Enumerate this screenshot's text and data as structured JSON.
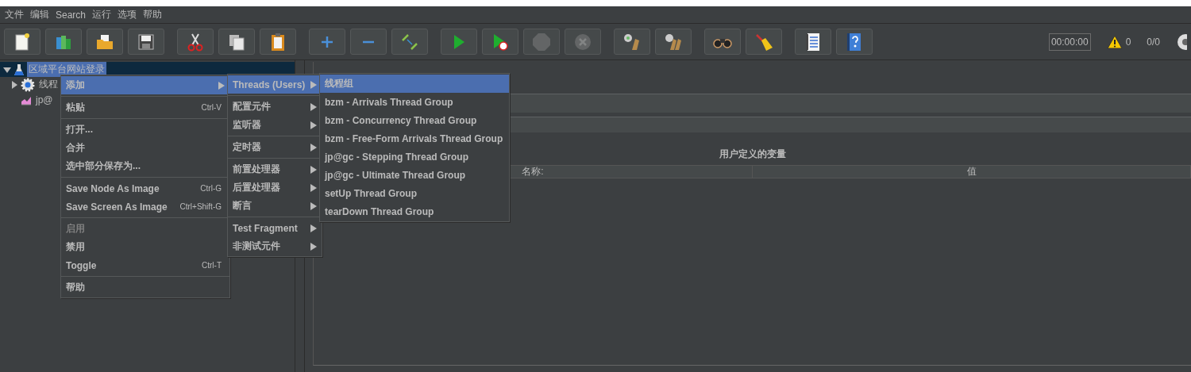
{
  "menu_bar": [
    "文件",
    "编辑",
    "Search",
    "运行",
    "选项",
    "帮助"
  ],
  "toolbar": {
    "groups": [
      [
        {
          "kind": "new",
          "disabled": false
        },
        {
          "kind": "templates",
          "disabled": false
        },
        {
          "kind": "open",
          "disabled": false
        },
        {
          "kind": "save",
          "disabled": false
        }
      ],
      [
        {
          "kind": "cut",
          "disabled": false
        },
        {
          "kind": "copy",
          "disabled": false
        },
        {
          "kind": "paste",
          "disabled": false
        }
      ],
      [
        {
          "kind": "plus",
          "disabled": false
        },
        {
          "kind": "minus",
          "disabled": false
        },
        {
          "kind": "toggle",
          "disabled": false
        }
      ],
      [
        {
          "kind": "start",
          "disabled": false
        },
        {
          "kind": "start_no_pause",
          "disabled": false
        },
        {
          "kind": "stop",
          "disabled": true
        },
        {
          "kind": "shutdown",
          "disabled": true
        }
      ],
      [
        {
          "kind": "clear",
          "disabled": false
        },
        {
          "kind": "clear_all",
          "disabled": false
        }
      ],
      [
        {
          "kind": "search",
          "disabled": false
        },
        {
          "kind": "reset_search",
          "disabled": false
        }
      ],
      [
        {
          "kind": "function_helper",
          "disabled": false
        },
        {
          "kind": "help",
          "disabled": false
        }
      ]
    ],
    "timer": "00:00:00",
    "warning_count": "0",
    "threads": "0/0"
  },
  "tree": [
    {
      "label": "区域平台网站登录",
      "kind": "flask",
      "expanded": true,
      "selected": true,
      "children": [
        {
          "label": "线程",
          "kind": "gear",
          "expanded": false,
          "selected": false
        },
        {
          "label": "jp@",
          "kind": "graph",
          "selected": false
        }
      ]
    }
  ],
  "right_panel": {
    "table_title": "用户定义的变量",
    "columns": [
      "名称:",
      "值"
    ]
  },
  "context_menu": [
    {
      "kind": "item",
      "label": "添加",
      "submenu": true,
      "selected": true,
      "disabled": false
    },
    {
      "kind": "separator"
    },
    {
      "kind": "item",
      "label": "粘贴",
      "shortcut": "Ctrl-V",
      "submenu": false,
      "selected": false,
      "disabled": false
    },
    {
      "kind": "separator"
    },
    {
      "kind": "item",
      "label": "打开...",
      "submenu": false,
      "selected": false,
      "disabled": false
    },
    {
      "kind": "item",
      "label": "合并",
      "submenu": false,
      "selected": false,
      "disabled": false
    },
    {
      "kind": "item",
      "label": "选中部分保存为...",
      "submenu": false,
      "selected": false,
      "disabled": false
    },
    {
      "kind": "separator"
    },
    {
      "kind": "item",
      "label": "Save Node As Image",
      "shortcut": "Ctrl-G",
      "submenu": false,
      "selected": false,
      "disabled": false
    },
    {
      "kind": "item",
      "label": "Save Screen As Image",
      "shortcut": "Ctrl+Shift-G",
      "submenu": false,
      "selected": false,
      "disabled": false
    },
    {
      "kind": "separator"
    },
    {
      "kind": "item",
      "label": "启用",
      "submenu": false,
      "selected": false,
      "disabled": true
    },
    {
      "kind": "item",
      "label": "禁用",
      "submenu": false,
      "selected": false,
      "disabled": false
    },
    {
      "kind": "item",
      "label": "Toggle",
      "shortcut": "Ctrl-T",
      "submenu": false,
      "selected": false,
      "disabled": false
    },
    {
      "kind": "separator"
    },
    {
      "kind": "item",
      "label": "帮助",
      "submenu": false,
      "selected": false,
      "disabled": false
    }
  ],
  "add_submenu": [
    {
      "kind": "item",
      "label": "Threads (Users)",
      "submenu": true,
      "selected": true,
      "disabled": false
    },
    {
      "kind": "separator"
    },
    {
      "kind": "item",
      "label": "配置元件",
      "submenu": true,
      "selected": false,
      "disabled": false
    },
    {
      "kind": "item",
      "label": "监听器",
      "submenu": true,
      "selected": false,
      "disabled": false
    },
    {
      "kind": "separator"
    },
    {
      "kind": "item",
      "label": "定时器",
      "submenu": true,
      "selected": false,
      "disabled": false
    },
    {
      "kind": "separator"
    },
    {
      "kind": "item",
      "label": "前置处理器",
      "submenu": true,
      "selected": false,
      "disabled": false
    },
    {
      "kind": "item",
      "label": "后置处理器",
      "submenu": true,
      "selected": false,
      "disabled": false
    },
    {
      "kind": "item",
      "label": "断言",
      "submenu": true,
      "selected": false,
      "disabled": false
    },
    {
      "kind": "separator"
    },
    {
      "kind": "item",
      "label": "Test Fragment",
      "submenu": true,
      "selected": false,
      "disabled": false
    },
    {
      "kind": "item",
      "label": "非测试元件",
      "submenu": true,
      "selected": false,
      "disabled": false
    }
  ],
  "threads_submenu": [
    {
      "kind": "item",
      "label": "线程组",
      "submenu": false,
      "selected": true,
      "disabled": false
    },
    {
      "kind": "item",
      "label": "bzm - Arrivals Thread Group",
      "submenu": false,
      "selected": false,
      "disabled": false
    },
    {
      "kind": "item",
      "label": "bzm - Concurrency Thread Group",
      "submenu": false,
      "selected": false,
      "disabled": false
    },
    {
      "kind": "item",
      "label": "bzm - Free-Form Arrivals Thread Group",
      "submenu": false,
      "selected": false,
      "disabled": false
    },
    {
      "kind": "item",
      "label": "jp@gc - Stepping Thread Group",
      "submenu": false,
      "selected": false,
      "disabled": false
    },
    {
      "kind": "item",
      "label": "jp@gc - Ultimate Thread Group",
      "submenu": false,
      "selected": false,
      "disabled": false
    },
    {
      "kind": "item",
      "label": "setUp Thread Group",
      "submenu": false,
      "selected": false,
      "disabled": false
    },
    {
      "kind": "item",
      "label": "tearDown Thread Group",
      "submenu": false,
      "selected": false,
      "disabled": false
    }
  ]
}
